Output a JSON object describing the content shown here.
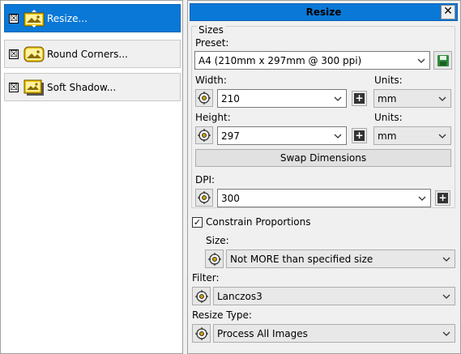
{
  "actions": [
    {
      "label": "Resize...",
      "checked": "☒",
      "selected": true
    },
    {
      "label": "Round Corners...",
      "checked": "☒",
      "selected": false
    },
    {
      "label": "Soft Shadow...",
      "checked": "☒",
      "selected": false
    }
  ],
  "panel": {
    "title": "Resize",
    "close": "✕"
  },
  "sizes": {
    "group_title": "Sizes",
    "preset_label": "Preset:",
    "preset_value": "A4 (210mm x 297mm @ 300 ppi)",
    "width_label": "Width:",
    "width_value": "210",
    "width_units_label": "Units:",
    "width_units_value": "mm",
    "height_label": "Height:",
    "height_value": "297",
    "height_units_label": "Units:",
    "height_units_value": "mm",
    "swap_label": "Swap Dimensions",
    "dpi_label": "DPI:",
    "dpi_value": "300"
  },
  "constrain": {
    "label": "Constrain Proportions",
    "checked": "✓"
  },
  "size_mode": {
    "label": "Size:",
    "value": "Not MORE than specified size"
  },
  "filter": {
    "label": "Filter:",
    "value": "Lanczos3"
  },
  "resize_type": {
    "label": "Resize Type:",
    "value": "Process All Images"
  },
  "plus_glyph": "+",
  "colors": {
    "accent": "#0a78d7",
    "save_green": "#2e8b3a"
  }
}
